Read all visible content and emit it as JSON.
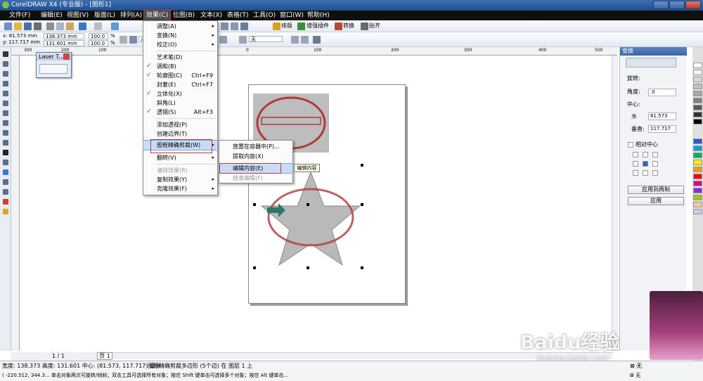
{
  "app": {
    "title": "CorelDRAW X4 (专业版) - [图形1]"
  },
  "menubar": {
    "items": [
      "文件(F)",
      "编辑(E)",
      "视图(V)",
      "版面(L)",
      "排列(A)",
      "效果(C)",
      "位图(B)",
      "文本(X)",
      "表格(T)",
      "工具(O)",
      "窗口(W)",
      "帮助(H)"
    ]
  },
  "toolbar": {
    "labels": [
      "排版",
      "增强插件",
      "转换",
      "贴齐"
    ],
    "outline_none": "无"
  },
  "propertybar": {
    "x": "x: 81.573 mm",
    "y": "y: 117.717 mm",
    "w": "138.373 mm",
    "h": "131.601 mm",
    "scale1": "100.0",
    "scale2": "100.0",
    "pct": "%",
    "rotation": ".0"
  },
  "ruler": {
    "marks": [
      "300",
      "200",
      "100",
      "0",
      "100",
      "200",
      "300",
      "400",
      "500"
    ]
  },
  "laser_window": {
    "title": "Laser T..."
  },
  "effects_menu": {
    "items": [
      {
        "label": "调整(A)",
        "arrow": "▸"
      },
      {
        "label": "变换(N)",
        "arrow": "▸"
      },
      {
        "label": "校正(O)",
        "arrow": "▸"
      },
      {
        "label": "艺术笔(D)"
      },
      {
        "label": "调和(B)",
        "checked": "✓"
      },
      {
        "label": "轮廓图(C)",
        "shortcut": "Ctrl+F9",
        "checked": "✓"
      },
      {
        "label": "封套(E)",
        "shortcut": "Ctrl+F7"
      },
      {
        "label": "立体化(X)",
        "checked": "✓"
      },
      {
        "label": "斜角(L)"
      },
      {
        "label": "透镜(S)",
        "shortcut": "Alt+F3",
        "checked": "✓"
      },
      {
        "label": "添加透视(P)"
      },
      {
        "label": "创建边界(T)"
      },
      {
        "label": "图框精确剪裁(W)",
        "arrow": "▸"
      },
      {
        "label": "翻转(V)",
        "arrow": "▸"
      },
      {
        "label": "清除效果(R)"
      },
      {
        "label": "复制效果(Y)",
        "arrow": "▸"
      },
      {
        "label": "克隆效果(F)",
        "arrow": "▸"
      }
    ]
  },
  "powerclip_submenu": {
    "items": [
      "放置在容器中(P)...",
      "提取内容(X)",
      "编辑内容(E)",
      "结束编辑(F)"
    ]
  },
  "tooltip": {
    "text": "编辑内容"
  },
  "docker": {
    "title": "变换",
    "rotation_label": "旋转:",
    "angle_label": "角度:",
    "angle_value": ".0",
    "center_label": "中心:",
    "h_label": "水",
    "h_value": "81.573",
    "v_label": "垂直:",
    "v_value": "117.717",
    "relative_center": "相对中心",
    "apply_copy": "应用到再制",
    "apply": "应用"
  },
  "nav": {
    "page_count": "1 / 1",
    "page_tab": "页 1"
  },
  "status": {
    "line1": "宽度: 138.373 高度: 131.601 中心: (81.573, 117.717) 毫米",
    "line1b": "图框精确剪裁多边形 (5个边) 在 图层 1 上",
    "line2": "( -220.512, 344.3... 单击对象两次可旋转/倾斜；双击工具可选择所有对象；按住 Shift 键单击可选择多个对象；按住 Alt 键单击...",
    "fill_none": "无",
    "outline_none": "无"
  },
  "watermark": {
    "text": "Baidu经验",
    "sub": "jingyan.baidu.com"
  },
  "colors": {
    "accent": "#2a63c5",
    "highlight_box": "#cc3333"
  }
}
